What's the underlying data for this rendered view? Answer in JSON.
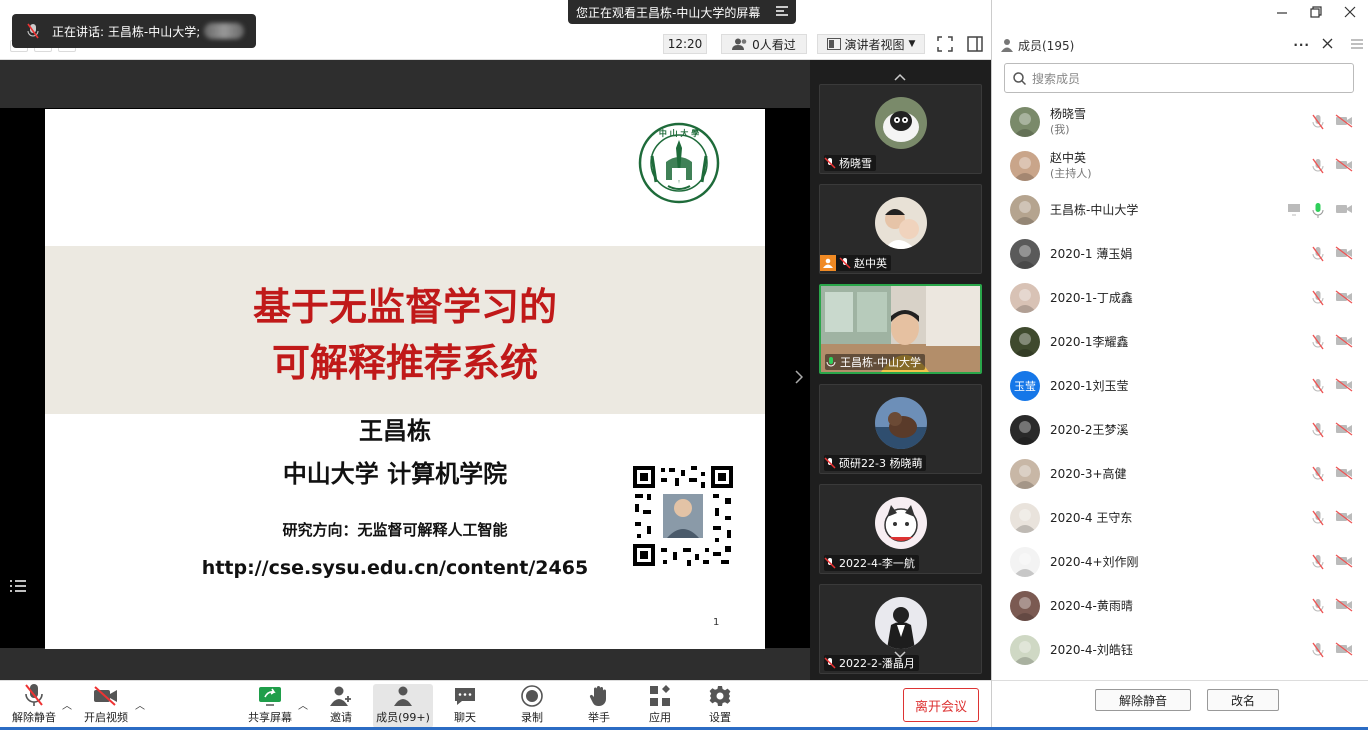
{
  "topbar": {
    "speaking_text": "正在讲话: 王昌栋-中山大学;",
    "viewing_text": "您正在观看王昌栋-中山大学的屏幕",
    "clock": "12:20",
    "watchers": "0人看过",
    "view_mode": "演讲者视图"
  },
  "slide": {
    "title_line1": "基于无监督学习的",
    "title_line2": "可解释推荐系统",
    "author": "王昌栋",
    "institution": "中山大学 计算机学院",
    "research": "研究方向：无监督可解释人工智能",
    "url": "http://cse.sysu.edu.cn/content/2465",
    "page_number": "1",
    "logo_ring_text": "SUN YAT-SEN UNIVERSITY",
    "logo_top_text": "中 山 大 學"
  },
  "tiles": [
    {
      "name": "杨晓雪",
      "mic": "muted"
    },
    {
      "name": "赵中英",
      "mic": "muted",
      "host_badge": true
    },
    {
      "name": "王昌栋-中山大学",
      "mic": "active",
      "active": true
    },
    {
      "name": "硕研22-3 杨晓萌",
      "mic": "muted"
    },
    {
      "name": "2022-4-李一航",
      "mic": "muted"
    },
    {
      "name": "2022-2-潘晶月",
      "mic": "muted"
    }
  ],
  "panel": {
    "title": "成员(195)",
    "search_placeholder": "搜索成员",
    "participants": [
      {
        "name": "杨晓雪",
        "sub": "(我)",
        "avatar_color": "#7a8a6a"
      },
      {
        "name": "赵中英",
        "sub": "(主持人)",
        "avatar_color": "#c9a58a"
      },
      {
        "name": "王昌栋-中山大学",
        "sub": "",
        "avatar_color": "#b5a48f",
        "speaking": true
      },
      {
        "name": "2020-1 薄玉娟",
        "sub": "",
        "avatar_color": "#5a5a5a"
      },
      {
        "name": "2020-1-丁成鑫",
        "sub": "",
        "avatar_color": "#d8c2b5"
      },
      {
        "name": "2020-1李耀鑫",
        "sub": "",
        "avatar_color": "#3f4a2e"
      },
      {
        "name": "2020-1刘玉莹",
        "sub": "",
        "avatar_color": "#1677e8",
        "avatar_text": "玉莹"
      },
      {
        "name": "2020-2王梦溪",
        "sub": "",
        "avatar_color": "#2a2a2a"
      },
      {
        "name": "2020-3+高健",
        "sub": "",
        "avatar_color": "#c8b7a6"
      },
      {
        "name": "2020-4 王守东",
        "sub": "",
        "avatar_color": "#e9e3dc"
      },
      {
        "name": "2020-4+刘作刚",
        "sub": "",
        "avatar_color": "#f3f3f3"
      },
      {
        "name": "2020-4-黄雨晴",
        "sub": "",
        "avatar_color": "#7b5a52"
      },
      {
        "name": "2020-4-刘皓钰",
        "sub": "",
        "avatar_color": "#cfd8c4"
      }
    ],
    "unmute_all": "解除静音",
    "rename": "改名"
  },
  "toolbar": {
    "unmute": "解除静音",
    "start_video": "开启视频",
    "share_screen": "共享屏幕",
    "invite": "邀请",
    "members": "成员(99+)",
    "chat": "聊天",
    "record": "录制",
    "raise_hand": "举手",
    "apps": "应用",
    "settings": "设置",
    "leave": "离开会议"
  },
  "colors": {
    "accent_green": "#2aa64a",
    "share_green": "#1f9e4a",
    "leave_red": "#d33333",
    "title_red": "#c01919",
    "sysu_green": "#1e6b3a"
  }
}
